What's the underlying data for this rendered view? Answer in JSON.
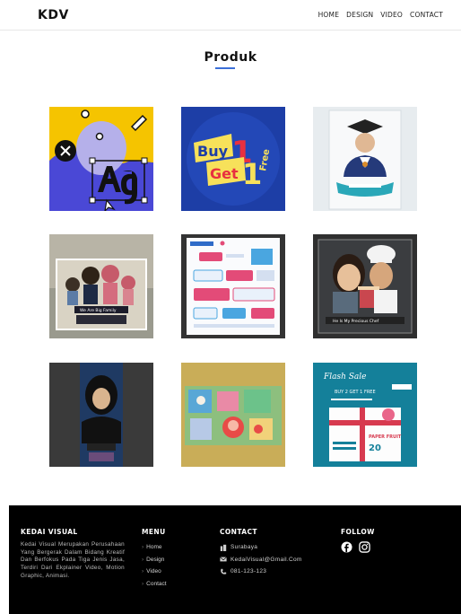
{
  "header": {
    "brand": "KDV",
    "nav": [
      "HOME",
      "DESIGN",
      "VIDEO",
      "CONTACT"
    ]
  },
  "section": {
    "title": "Produk"
  },
  "gallery": {
    "tile4_text": "We Are Big Family",
    "tile6_text": "He Is My Precious Chef",
    "tile9_title": "Flash Sale",
    "tile9_promo": "BUY 2 GET 1 FREE",
    "tile9_product": "PAPER FRUIT",
    "tile9_number": "20"
  },
  "footer": {
    "about": {
      "heading": "KEDAI VISUAL",
      "text": "Kedai Visual Merupakan Perusahaan Yang Bergerak Dalam Bidang Kreatif Dan Berfokus Pada Tiga Jenis Jasa, Terdiri Dari Ekplainer Video, Motion Graphic, Animasi."
    },
    "menu": {
      "heading": "MENU",
      "items": [
        "Home",
        "Design",
        "Video",
        "Contact"
      ]
    },
    "contact": {
      "heading": "CONTACT",
      "city": "Surabaya",
      "email": "KedaiVisual@Gmail.Com",
      "phone": "081-123-123"
    },
    "follow": {
      "heading": "FOLLOW"
    }
  },
  "colors": {
    "accent": "#3b6fd8",
    "footer_bg": "#000000"
  }
}
